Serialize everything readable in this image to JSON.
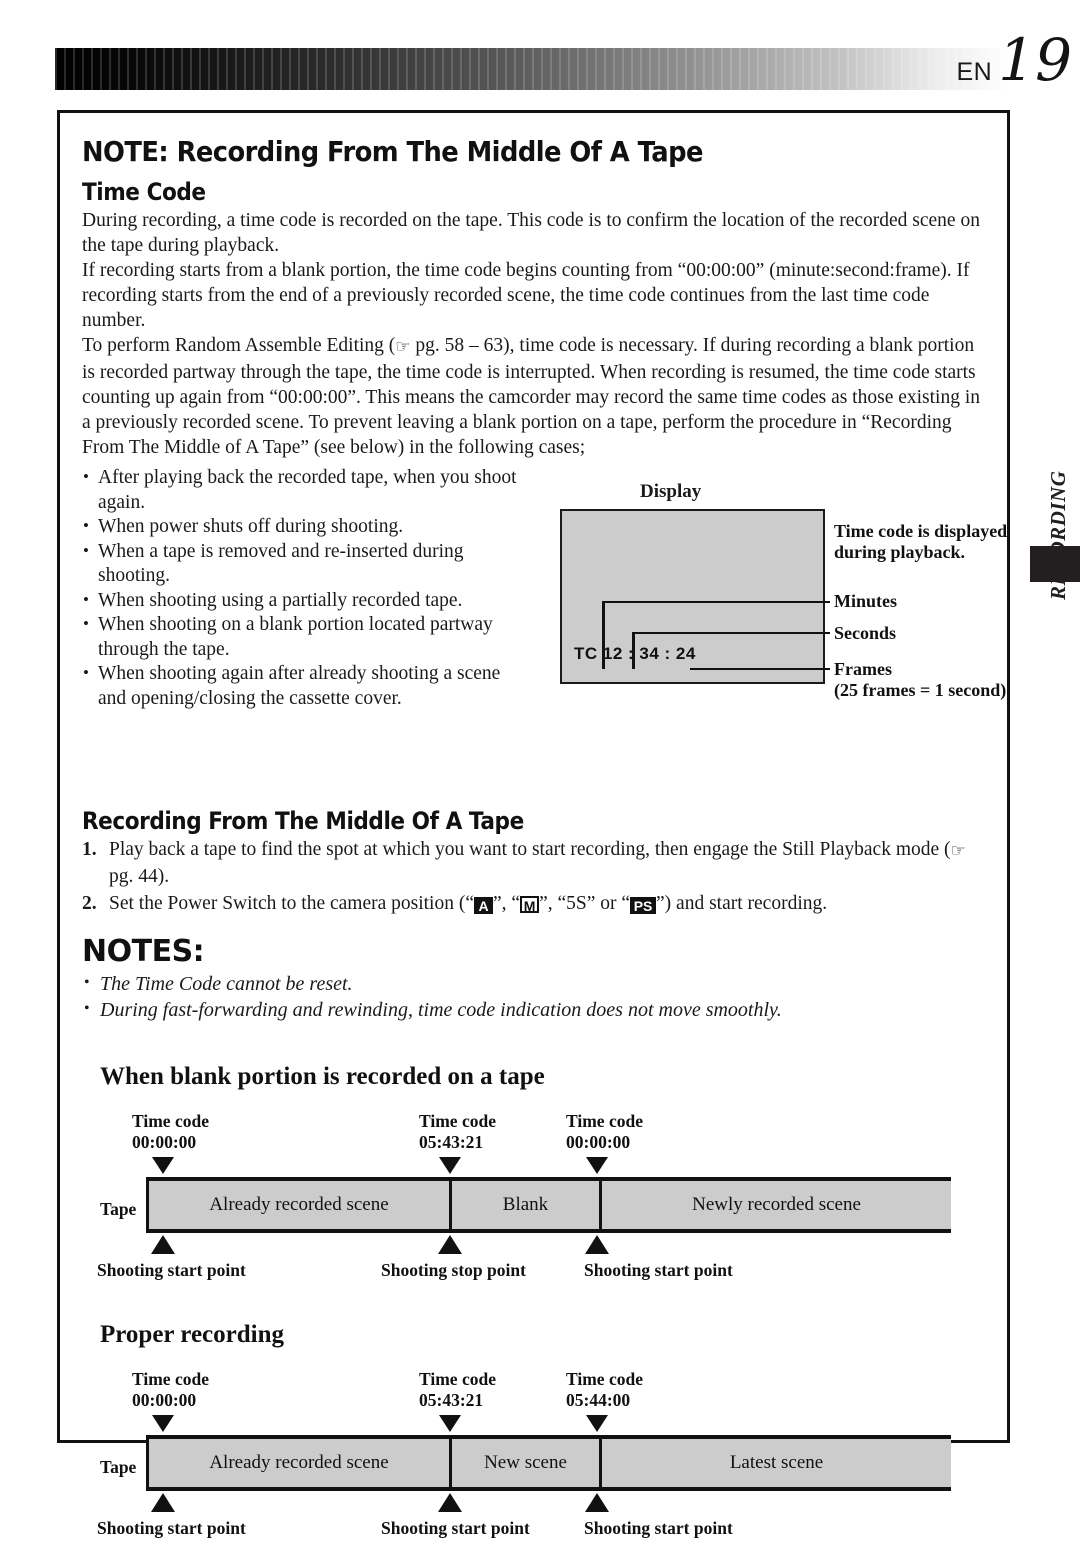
{
  "header": {
    "lang": "EN",
    "page_number": "19"
  },
  "side_tab": {
    "label": "RECORDING"
  },
  "main": {
    "note_heading": "NOTE: Recording From The Middle Of A Tape",
    "time_code_heading": "Time Code",
    "paragraphs": [
      "During recording, a time code is recorded on the tape. This code is to confirm the location of the recorded scene on the tape during playback.",
      "If recording starts from a blank portion, the time code begins counting from “00:00:00” (minute:second:frame). If recording starts from the end of a previously recorded scene, the time code continues from the last time code number."
    ],
    "paragraph3_a": "To perform Random Assemble Editing (",
    "paragraph3_ref": " pg. 58 – 63), time code is necessary. If during recording a blank portion is recorded partway through the tape, the time code is interrupted. When recording is resumed, the time code starts counting up again from “00:00:00”. This means the camcorder may record the same time codes as those existing in a previously recorded scene. To prevent leaving a blank portion on a tape, perform the procedure in “Recording From The Middle of A Tape” (see below) in the following cases;",
    "bullets": [
      "After playing back the recorded tape, when you shoot again.",
      "When power shuts off during shooting.",
      "When a tape is removed and re-inserted during shooting.",
      "When shooting using a partially recorded tape.",
      "When shooting on a blank portion located partway through the tape.",
      "When shooting again after already shooting a scene and opening/closing the cassette cover."
    ]
  },
  "display_figure": {
    "title": "Display",
    "tc_readout": "TC  12 : 34 : 24",
    "callouts": [
      {
        "text_line1": "Time code is displayed",
        "text_line2": "during playback."
      },
      {
        "text_line1": "Minutes",
        "text_line2": ""
      },
      {
        "text_line1": "Seconds",
        "text_line2": ""
      },
      {
        "text_line1": "Frames",
        "text_line2": "(25 frames = 1 second)"
      }
    ]
  },
  "recording_section": {
    "heading": "Recording From The Middle Of A Tape",
    "step1_a": "Play back a tape to find the spot at which you want to start recording, then engage the Still Playback mode (",
    "step1_b": " pg. 44).",
    "step2_a": "Set the Power Switch to the camera position (“",
    "step2_icon1": "A",
    "step2_b": "”, “",
    "step2_icon2": "M",
    "step2_c": "”, “5S” or “",
    "step2_icon3": "PS",
    "step2_d": "”) and start recording."
  },
  "notes_section": {
    "heading": "NOTES:",
    "items": [
      "The Time Code cannot be reset.",
      "During fast-forwarding and rewinding, time code indication does not move smoothly."
    ]
  },
  "diagram1": {
    "title": "When blank portion is recorded on a tape",
    "tape_label": "Tape",
    "timecodes": [
      {
        "label": "Time code",
        "value": "00:00:00"
      },
      {
        "label": "Time code",
        "value": "05:43:21"
      },
      {
        "label": "Time code",
        "value": "00:00:00"
      }
    ],
    "segments": [
      "Already recorded scene",
      "Blank",
      "Newly recorded scene"
    ],
    "points": [
      "Shooting start point",
      "Shooting stop point",
      "Shooting start point"
    ]
  },
  "diagram2": {
    "title": "Proper recording",
    "tape_label": "Tape",
    "timecodes": [
      {
        "label": "Time code",
        "value": "00:00:00"
      },
      {
        "label": "Time code",
        "value": "05:43:21"
      },
      {
        "label": "Time code",
        "value": "05:44:00"
      }
    ],
    "segments": [
      "Already recorded scene",
      "New scene",
      "Latest scene"
    ],
    "points": [
      "Shooting start point",
      "Shooting start point",
      "Shooting start point"
    ]
  },
  "icons": {
    "pointing_hand": "☞"
  }
}
